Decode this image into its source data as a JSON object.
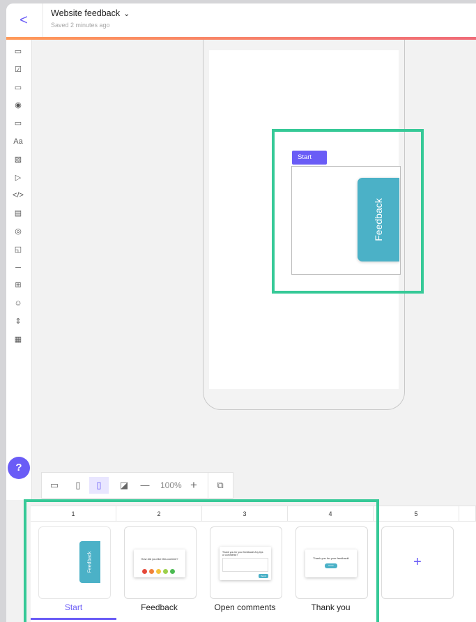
{
  "header": {
    "back_label": "<",
    "title": "Website feedback",
    "title_chevron": "⌄",
    "subtitle": "Saved 2 minutes ago"
  },
  "toolbar": {
    "tools": [
      {
        "name": "text-input-icon",
        "glyph": "▭"
      },
      {
        "name": "checkbox-icon",
        "glyph": "☑"
      },
      {
        "name": "text-field-icon",
        "glyph": "▭"
      },
      {
        "name": "radio-icon",
        "glyph": "◉"
      },
      {
        "name": "button-icon",
        "glyph": "▭"
      },
      {
        "name": "text-icon",
        "glyph": "Aa"
      },
      {
        "name": "image-icon",
        "glyph": "▨"
      },
      {
        "name": "video-icon",
        "glyph": "▷"
      },
      {
        "name": "code-icon",
        "glyph": "</>"
      },
      {
        "name": "form-icon",
        "glyph": "▤"
      },
      {
        "name": "social-icon",
        "glyph": "◎"
      },
      {
        "name": "shapes-icon",
        "glyph": "◱"
      },
      {
        "name": "divider-icon",
        "glyph": "─"
      },
      {
        "name": "countdown-icon",
        "glyph": "⊞"
      },
      {
        "name": "emoji-icon",
        "glyph": "☺"
      },
      {
        "name": "spinner-icon",
        "glyph": "⇕"
      },
      {
        "name": "calendar-icon",
        "glyph": "▦"
      }
    ]
  },
  "canvas": {
    "page_chip": "Start",
    "feedback_tab": "Feedback"
  },
  "help_label": "?",
  "device_bar": {
    "zoom_minus": "—",
    "zoom": "100%",
    "zoom_plus": "+"
  },
  "pages": [
    {
      "number": "1",
      "label": "Start",
      "active": true
    },
    {
      "number": "2",
      "label": "Feedback"
    },
    {
      "number": "3",
      "label": "Open comments"
    },
    {
      "number": "4",
      "label": "Thank you"
    },
    {
      "number": "5",
      "label": ""
    }
  ],
  "page_thumbs": {
    "start_tab": "Feedback",
    "feedback_question": "How did you like this content?",
    "comments_prompt": "Thank you for your feedback! Any tips or comments?",
    "comments_send": "Send",
    "thankyou_text": "Thank you for your feedback!",
    "thankyou_btn": "Close",
    "add_page": "+"
  },
  "colors": {
    "accent": "#6a5cf6",
    "highlight": "#36c997",
    "feedback_tab": "#4bb1c7",
    "emoji": [
      "#e5493a",
      "#f0823a",
      "#f3c53c",
      "#9cd04b",
      "#4cbb53"
    ]
  }
}
